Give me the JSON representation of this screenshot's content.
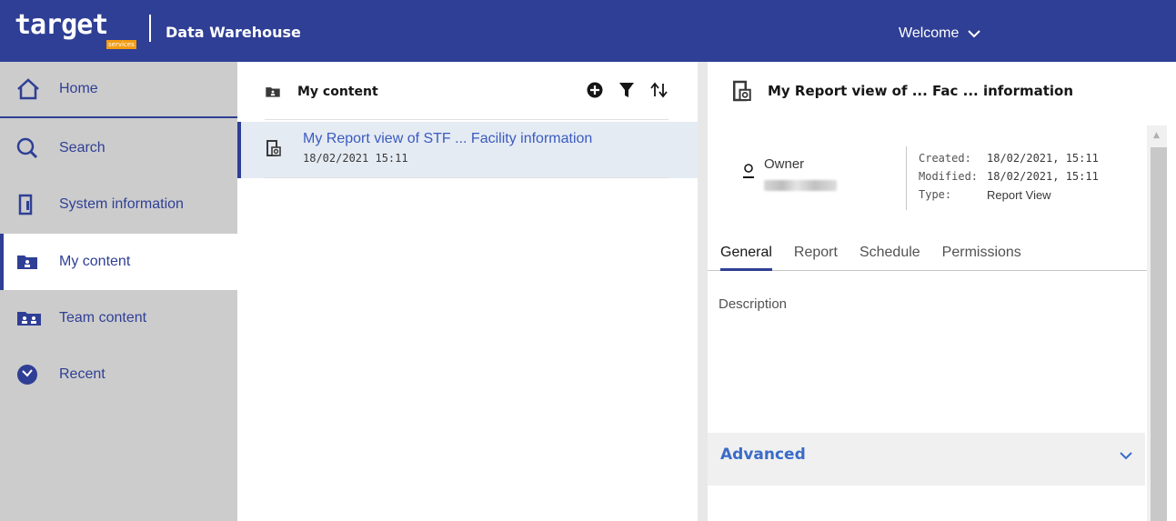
{
  "header": {
    "logo_text": "target",
    "logo_sub": "services",
    "app_title": "Data Warehouse",
    "welcome_label": "Welcome"
  },
  "sidebar": {
    "items": [
      {
        "label": "Home",
        "icon": "home-icon"
      },
      {
        "label": "Search",
        "icon": "search-icon"
      },
      {
        "label": "System information",
        "icon": "system-info-icon"
      },
      {
        "label": "My content",
        "icon": "folder-user-icon",
        "active": true
      },
      {
        "label": "Team content",
        "icon": "folder-team-icon"
      },
      {
        "label": "Recent",
        "icon": "recent-icon"
      }
    ]
  },
  "content": {
    "title": "My content",
    "items": [
      {
        "title": "My Report view of STF ... Facility information",
        "date": "18/02/2021 15:11",
        "selected": true
      }
    ]
  },
  "details": {
    "title": "My Report view of ... Fac ... information",
    "owner_label": "Owner",
    "meta": {
      "created_label": "Created:",
      "created_value": "18/02/2021, 15:11",
      "modified_label": "Modified:",
      "modified_value": "18/02/2021, 15:11",
      "type_label": "Type:",
      "type_value": "Report View"
    },
    "tabs": [
      "General",
      "Report",
      "Schedule",
      "Permissions"
    ],
    "active_tab": "General",
    "description_label": "Description",
    "advanced_label": "Advanced"
  },
  "colors": {
    "brand": "#2f3f95",
    "sidebar_bg": "#cccccc",
    "selected_row": "#e5ebf3",
    "link": "#3a5bbf"
  }
}
